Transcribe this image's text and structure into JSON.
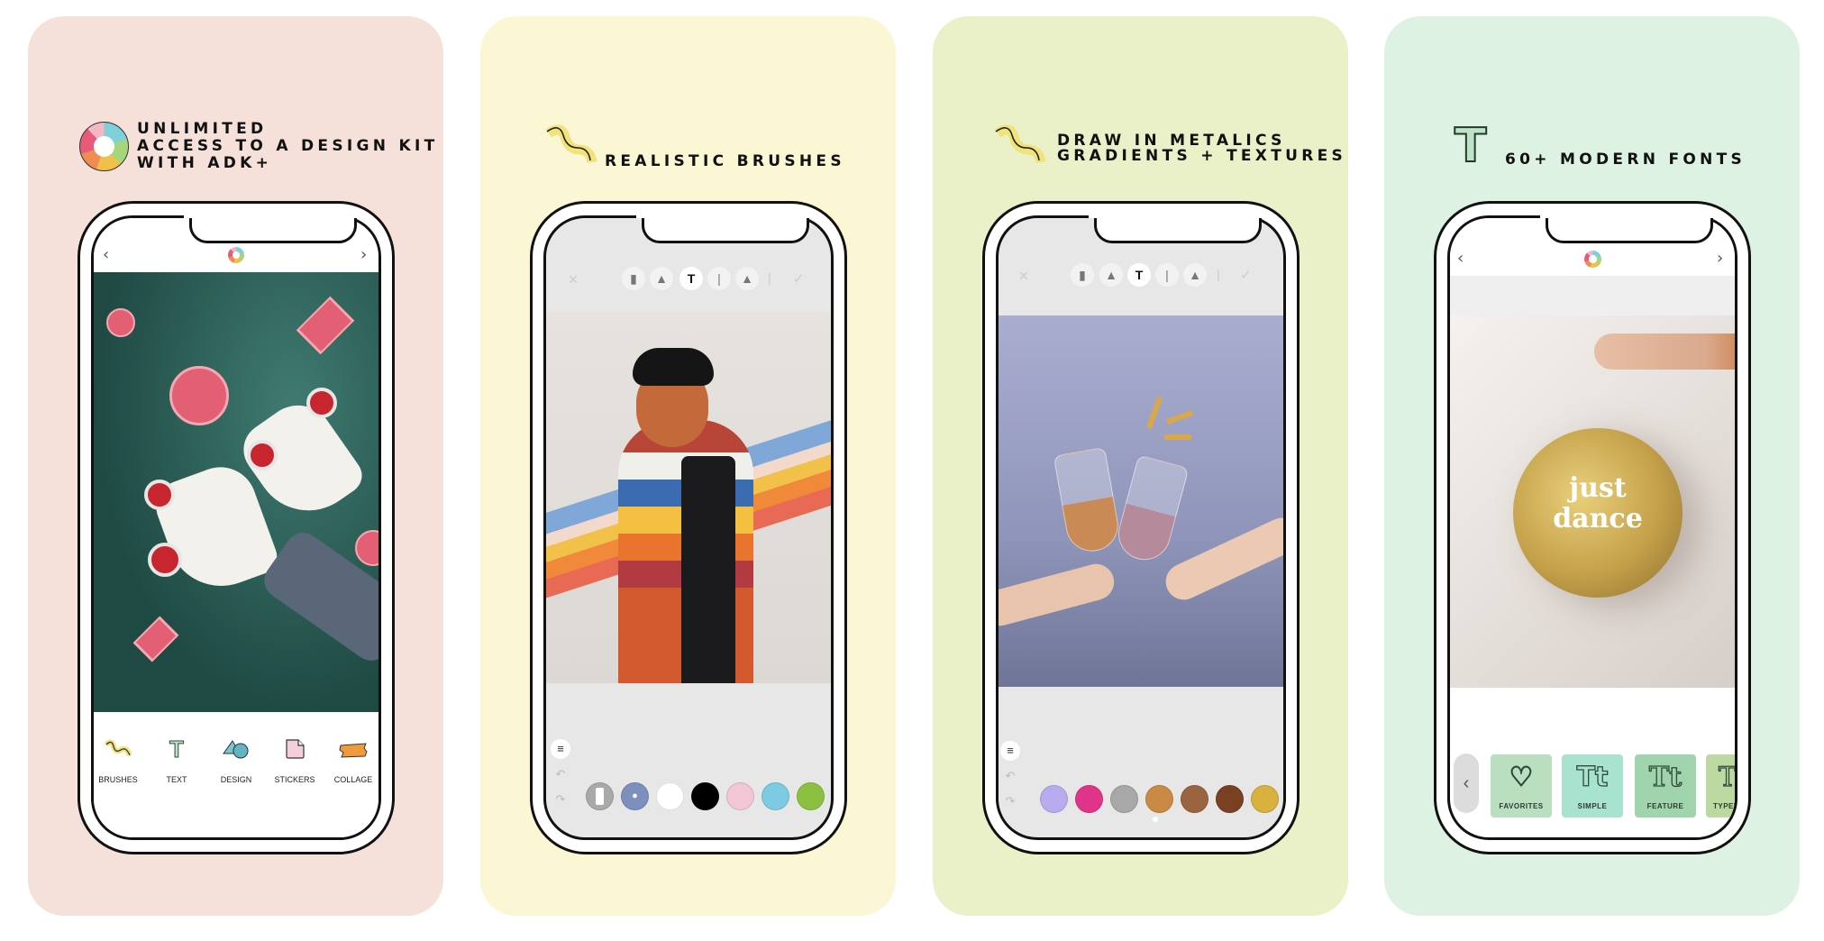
{
  "panels": [
    {
      "background": "#f6e1da",
      "title_lines": [
        "UNLIMITED",
        "ACCESS TO A DESIGN KIT",
        "WITH ADK+"
      ],
      "title_icon": "logo-ring-icon",
      "header": {
        "back": "‹",
        "forward": "›"
      },
      "bottom_nav": [
        {
          "label": "BRUSHES",
          "icon": "brush-squiggle-icon"
        },
        {
          "label": "TEXT",
          "icon": "text-t-icon"
        },
        {
          "label": "DESIGN",
          "icon": "shapes-icon"
        },
        {
          "label": "STICKERS",
          "icon": "sticker-icon"
        },
        {
          "label": "COLLAGE",
          "icon": "tape-icon"
        }
      ]
    },
    {
      "background": "#fbf6d4",
      "title_lines": [
        "REALISTIC BRUSHES"
      ],
      "title_icon": "brush-squiggle-icon",
      "toolbar": {
        "close": "✕",
        "confirm": "✓",
        "tools": [
          "marker",
          "brush",
          "paint-roller",
          "pen",
          "pencil",
          "fine-liner"
        ]
      },
      "swatches": [
        "eraser",
        "#7d8fbd",
        "#ffffff",
        "#000000",
        "#f3c6d6",
        "#7ccbe3",
        "#8cc043"
      ]
    },
    {
      "background": "#eaf0c8",
      "title_lines": [
        "DRAW IN METALICS",
        "GRADIENTS + TEXTURES"
      ],
      "title_icon": "brush-squiggle-icon",
      "toolbar": {
        "close": "✕",
        "confirm": "✓",
        "tools": [
          "marker",
          "brush",
          "paint-roller",
          "pen",
          "pencil",
          "fine-liner"
        ]
      },
      "swatches": [
        "#b8acee",
        "#e0348a",
        "#a8a8a8",
        "#c98a45",
        "#9b6440",
        "#7a4022",
        "#d8b13e",
        "#c58d3e"
      ]
    },
    {
      "background": "#def2e4",
      "title_lines": [
        "60+ MODERN FONTS"
      ],
      "title_icon": "text-t-icon",
      "header": {
        "back": "‹",
        "forward": "›"
      },
      "overlay_text": [
        "just",
        "dance"
      ],
      "font_tiles": [
        {
          "label": "FAVORITES",
          "glyph": "♡",
          "color": "#b9dfc0"
        },
        {
          "label": "SIMPLE",
          "glyph": "Tt",
          "color": "#a8e3cf"
        },
        {
          "label": "FEATURE",
          "glyph": "Tt",
          "color": "#9fd4ac"
        },
        {
          "label": "TYPEW",
          "glyph": "T",
          "color": "#bcd9a2"
        }
      ],
      "tiles_back": "‹"
    }
  ]
}
